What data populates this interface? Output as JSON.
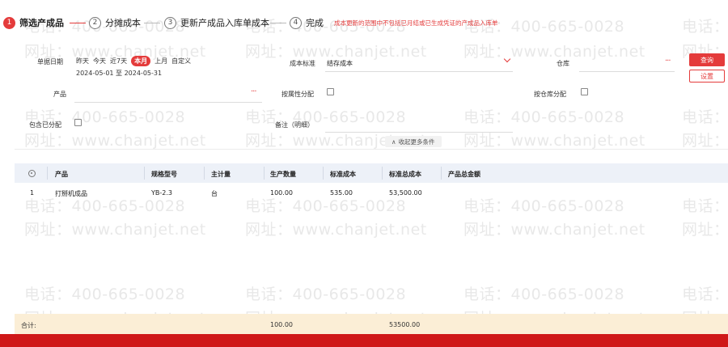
{
  "watermark": {
    "phone": "电话：400-665-0028",
    "site": "网址：www.chanjet.net"
  },
  "steps": [
    {
      "num": "1",
      "label": "筛选产成品",
      "state": "active"
    },
    {
      "num": "2",
      "label": "分摊成本",
      "state": "todo"
    },
    {
      "num": "3",
      "label": "更新产成品入库单成本",
      "state": "todo"
    },
    {
      "num": "4",
      "label": "完成",
      "state": "todo"
    }
  ],
  "step_note": "成本更新的范围中不包括已月结或已生成凭证的产成品入库单",
  "filter": {
    "date_label": "单据日期",
    "quick_dates": [
      "昨天",
      "今天",
      "近7天",
      "本月",
      "上月",
      "自定义"
    ],
    "quick_selected": "本月",
    "date_range": "2024-05-01 至 2024-05-31",
    "cost_standard_label": "成本标准",
    "cost_standard_value": "结存成本",
    "warehouse_label": "仓库",
    "warehouse_value": "",
    "product_label": "产品",
    "product_value": "",
    "by_attr_label": "按属性分配",
    "by_warehouse_label": "按仓库分配",
    "include_allocated_label": "包含已分配",
    "remark_label": "备注（明细）",
    "collapse_label": "收起更多条件",
    "query_button": "查询",
    "settings_button": "设置"
  },
  "table": {
    "columns": [
      "产品",
      "规格型号",
      "主计量",
      "生产数量",
      "标准成本",
      "标准总成本",
      "产品总金额"
    ],
    "rows": [
      {
        "idx": "1",
        "product": "打掰机成品",
        "spec": "YB-2.3",
        "unit": "台",
        "qty": "100.00",
        "std_cost": "535.00",
        "std_total": "53,500.00",
        "amount": ""
      }
    ],
    "footer": {
      "label": "合计:",
      "qty": "100.00",
      "std_total": "53500.00"
    }
  },
  "colors": {
    "accent": "#e43b3b",
    "header_bg": "#edf1f8",
    "footer_bg": "#fbeed6",
    "bottom_bar": "#cf1818"
  }
}
